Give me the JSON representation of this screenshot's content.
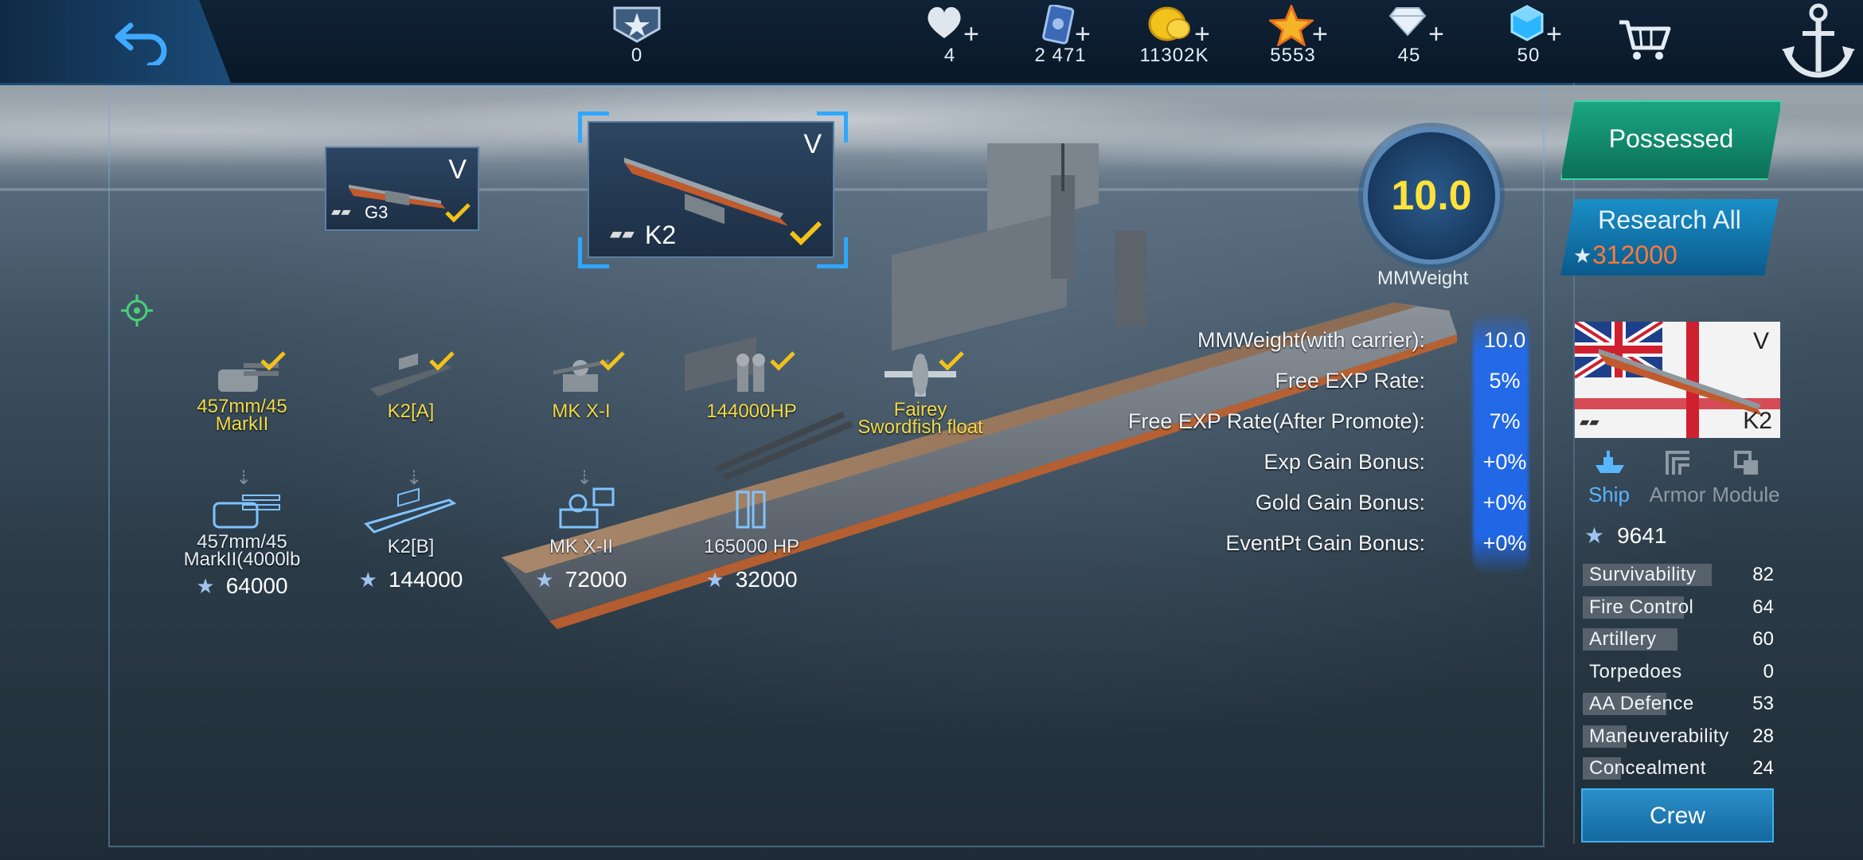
{
  "colors": {
    "accent_blue": "#2fa7ff",
    "check_yellow": "#f3c21a",
    "mm_yellow": "#ffe23a",
    "cost_orange": "#ff7a3a",
    "possessed_green": "#1aa683"
  },
  "topbar": {
    "back_icon": "back-arrow-icon",
    "resources": [
      {
        "id": "rank",
        "icon": "rank-badge-icon",
        "value": "0",
        "plus": false
      },
      {
        "id": "hearts",
        "icon": "heart-icon",
        "value": "4",
        "plus": true
      },
      {
        "id": "cards",
        "icon": "card-icon",
        "value": "2 471",
        "plus": true
      },
      {
        "id": "gold",
        "icon": "gold-coin-icon",
        "value": "11302K",
        "plus": true
      },
      {
        "id": "star",
        "icon": "star-icon",
        "value": "5553",
        "plus": true
      },
      {
        "id": "diamond",
        "icon": "diamond-icon",
        "value": "45",
        "plus": true
      },
      {
        "id": "crystal",
        "icon": "crystal-icon",
        "value": "50",
        "plus": true
      }
    ],
    "shop_icon": "shopping-cart-icon",
    "anchor_icon": "anchor-icon"
  },
  "ship_cards": [
    {
      "name": "G3",
      "tier": "V",
      "owned": true
    },
    {
      "name": "K2",
      "tier": "V",
      "owned": true,
      "selected": true
    }
  ],
  "mm": {
    "value": "10.0",
    "label": "MMWeight"
  },
  "stats": [
    {
      "label": "MMWeight(with carrier):",
      "value": "10.0"
    },
    {
      "label": "Free EXP Rate:",
      "value": "5%"
    },
    {
      "label": "Free EXP Rate(After Promote):",
      "value": "7%"
    },
    {
      "label": "Exp Gain Bonus:",
      "value": "+0%"
    },
    {
      "label": "Gold Gain Bonus:",
      "value": "+0%"
    },
    {
      "label": "EventPt Gain Bonus:",
      "value": "+0%"
    }
  ],
  "modules_installed": [
    {
      "label_1": "457mm/45",
      "label_2": "MarkII",
      "icon": "gun-turret-icon"
    },
    {
      "label_1": "K2[A]",
      "label_2": "",
      "icon": "hull-icon"
    },
    {
      "label_1": "MK X-I",
      "label_2": "",
      "icon": "fire-control-icon"
    },
    {
      "label_1": "144000HP",
      "label_2": "",
      "icon": "engine-icon"
    },
    {
      "label_1": "Fairey",
      "label_2": "Swordfish float",
      "icon": "plane-icon"
    }
  ],
  "modules_upgrade": [
    {
      "label_1": "457mm/45",
      "label_2": "MarkII(4000lb",
      "cost": "64000",
      "icon": "gun-turret-icon"
    },
    {
      "label_1": "K2[B]",
      "label_2": "",
      "cost": "144000",
      "icon": "hull-icon"
    },
    {
      "label_1": "MK X-II",
      "label_2": "",
      "cost": "72000",
      "icon": "fire-control-icon"
    },
    {
      "label_1": "165000 HP",
      "label_2": "",
      "cost": "32000",
      "icon": "engine-icon"
    }
  ],
  "right_panel": {
    "possessed": "Possessed",
    "research_all": "Research All",
    "research_cost": "312000",
    "ship_name": "K2",
    "ship_tier": "V",
    "tabs": [
      {
        "label": "Ship"
      },
      {
        "label": "Armor"
      },
      {
        "label": "Module"
      }
    ],
    "points": "9641",
    "attributes": [
      {
        "label": "Survivability",
        "value": "82",
        "level": 0.82
      },
      {
        "label": "Fire Control",
        "value": "64",
        "level": 0.64
      },
      {
        "label": "Artillery",
        "value": "60",
        "level": 0.6
      },
      {
        "label": "Torpedoes",
        "value": "0",
        "level": 0
      },
      {
        "label": "AA Defence",
        "value": "53",
        "level": 0.53
      },
      {
        "label": "Maneuverability",
        "value": "28",
        "level": 0.28
      },
      {
        "label": "Concealment",
        "value": "24",
        "level": 0.24
      }
    ],
    "crew": "Crew"
  }
}
